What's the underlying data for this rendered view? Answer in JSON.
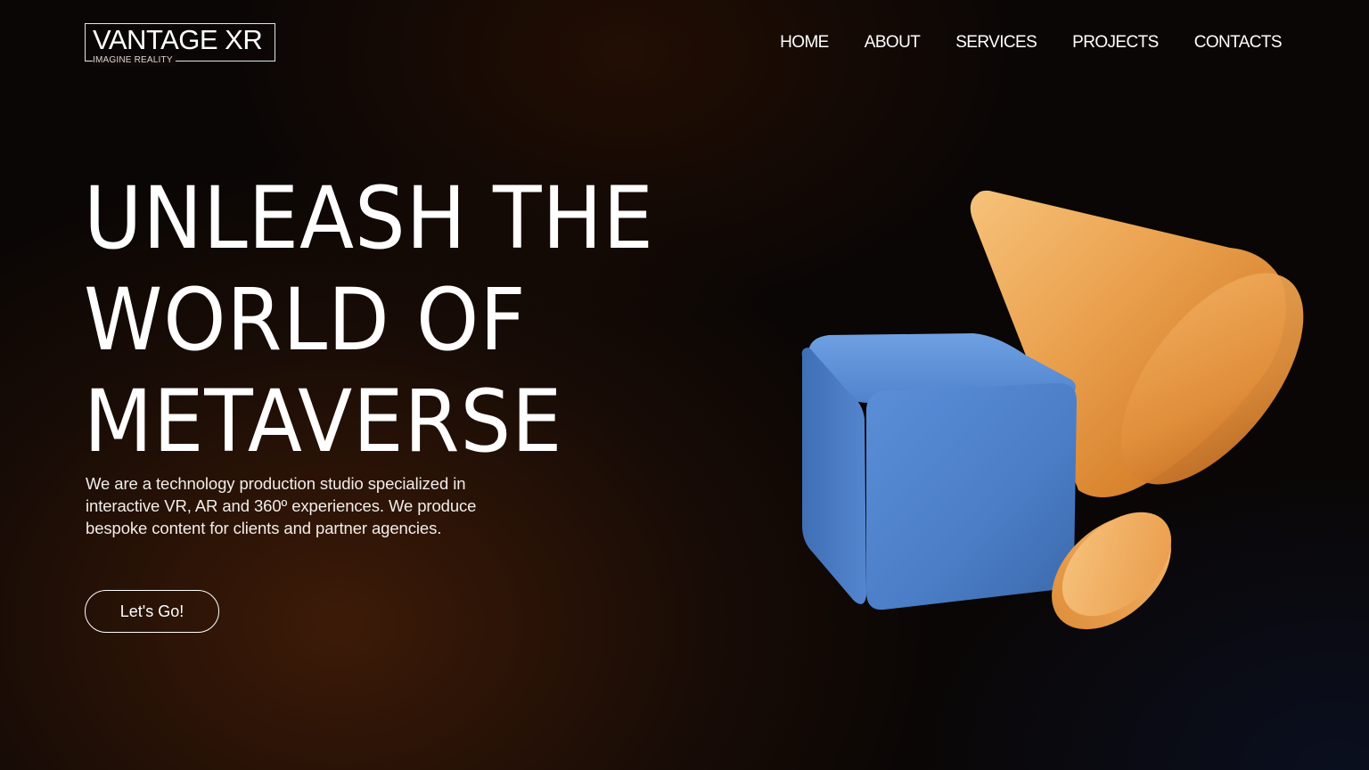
{
  "brand": {
    "name": "VANTAGE XR",
    "tagline": "IMAGINE REALITY"
  },
  "nav": {
    "items": [
      {
        "label": "HOME"
      },
      {
        "label": "ABOUT"
      },
      {
        "label": "SERVICES"
      },
      {
        "label": "PROJECTS"
      },
      {
        "label": "CONTACTS"
      }
    ]
  },
  "hero": {
    "title_lines": [
      "UNLEASH THE",
      "WORLD OF",
      "METAVERSE"
    ],
    "description": "We are a technology production studio specialized in interactive VR, AR and 360º experiences. We produce bespoke content for clients and partner agencies.",
    "cta_label": "Let's Go!"
  },
  "colors": {
    "cube": "#4a7fc9",
    "cone": "#e89a45",
    "background": "#0a0605"
  },
  "illustration": {
    "shapes": [
      "cube",
      "cone",
      "disc"
    ]
  }
}
